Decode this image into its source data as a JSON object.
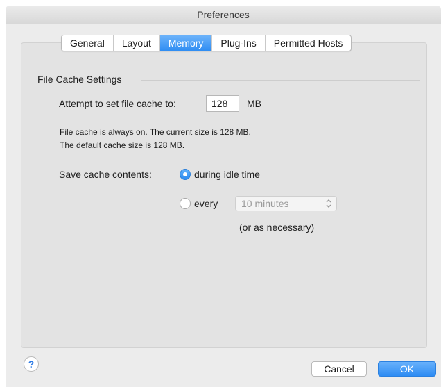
{
  "window": {
    "title": "Preferences"
  },
  "tabs": [
    {
      "label": "General",
      "active": false
    },
    {
      "label": "Layout",
      "active": false
    },
    {
      "label": "Memory",
      "active": true
    },
    {
      "label": "Plug-Ins",
      "active": false
    },
    {
      "label": "Permitted Hosts",
      "active": false
    }
  ],
  "section": {
    "title": "File Cache Settings"
  },
  "cache": {
    "label": "Attempt to set file cache to:",
    "value": "128",
    "unit": "MB",
    "info_line1": "File cache is always on. The current size is 128 MB.",
    "info_line2": "The default cache size is 128 MB."
  },
  "save": {
    "label": "Save cache contents:",
    "options": [
      {
        "label": "during idle time",
        "selected": true
      },
      {
        "label": "every",
        "selected": false
      }
    ],
    "interval": {
      "value": "10 minutes",
      "enabled": false
    },
    "note": "(or as necessary)"
  },
  "footer": {
    "help": "?",
    "cancel": "Cancel",
    "ok": "OK"
  },
  "colors": {
    "accent": "#2f8df3",
    "window_bg": "#ececec",
    "panel_bg": "#e3e3e3"
  },
  "icons": {
    "help": "question-icon",
    "popup": "chevron-up-down-icon",
    "radio_selected": "radio-selected-icon",
    "radio_unselected": "radio-unselected-icon"
  }
}
